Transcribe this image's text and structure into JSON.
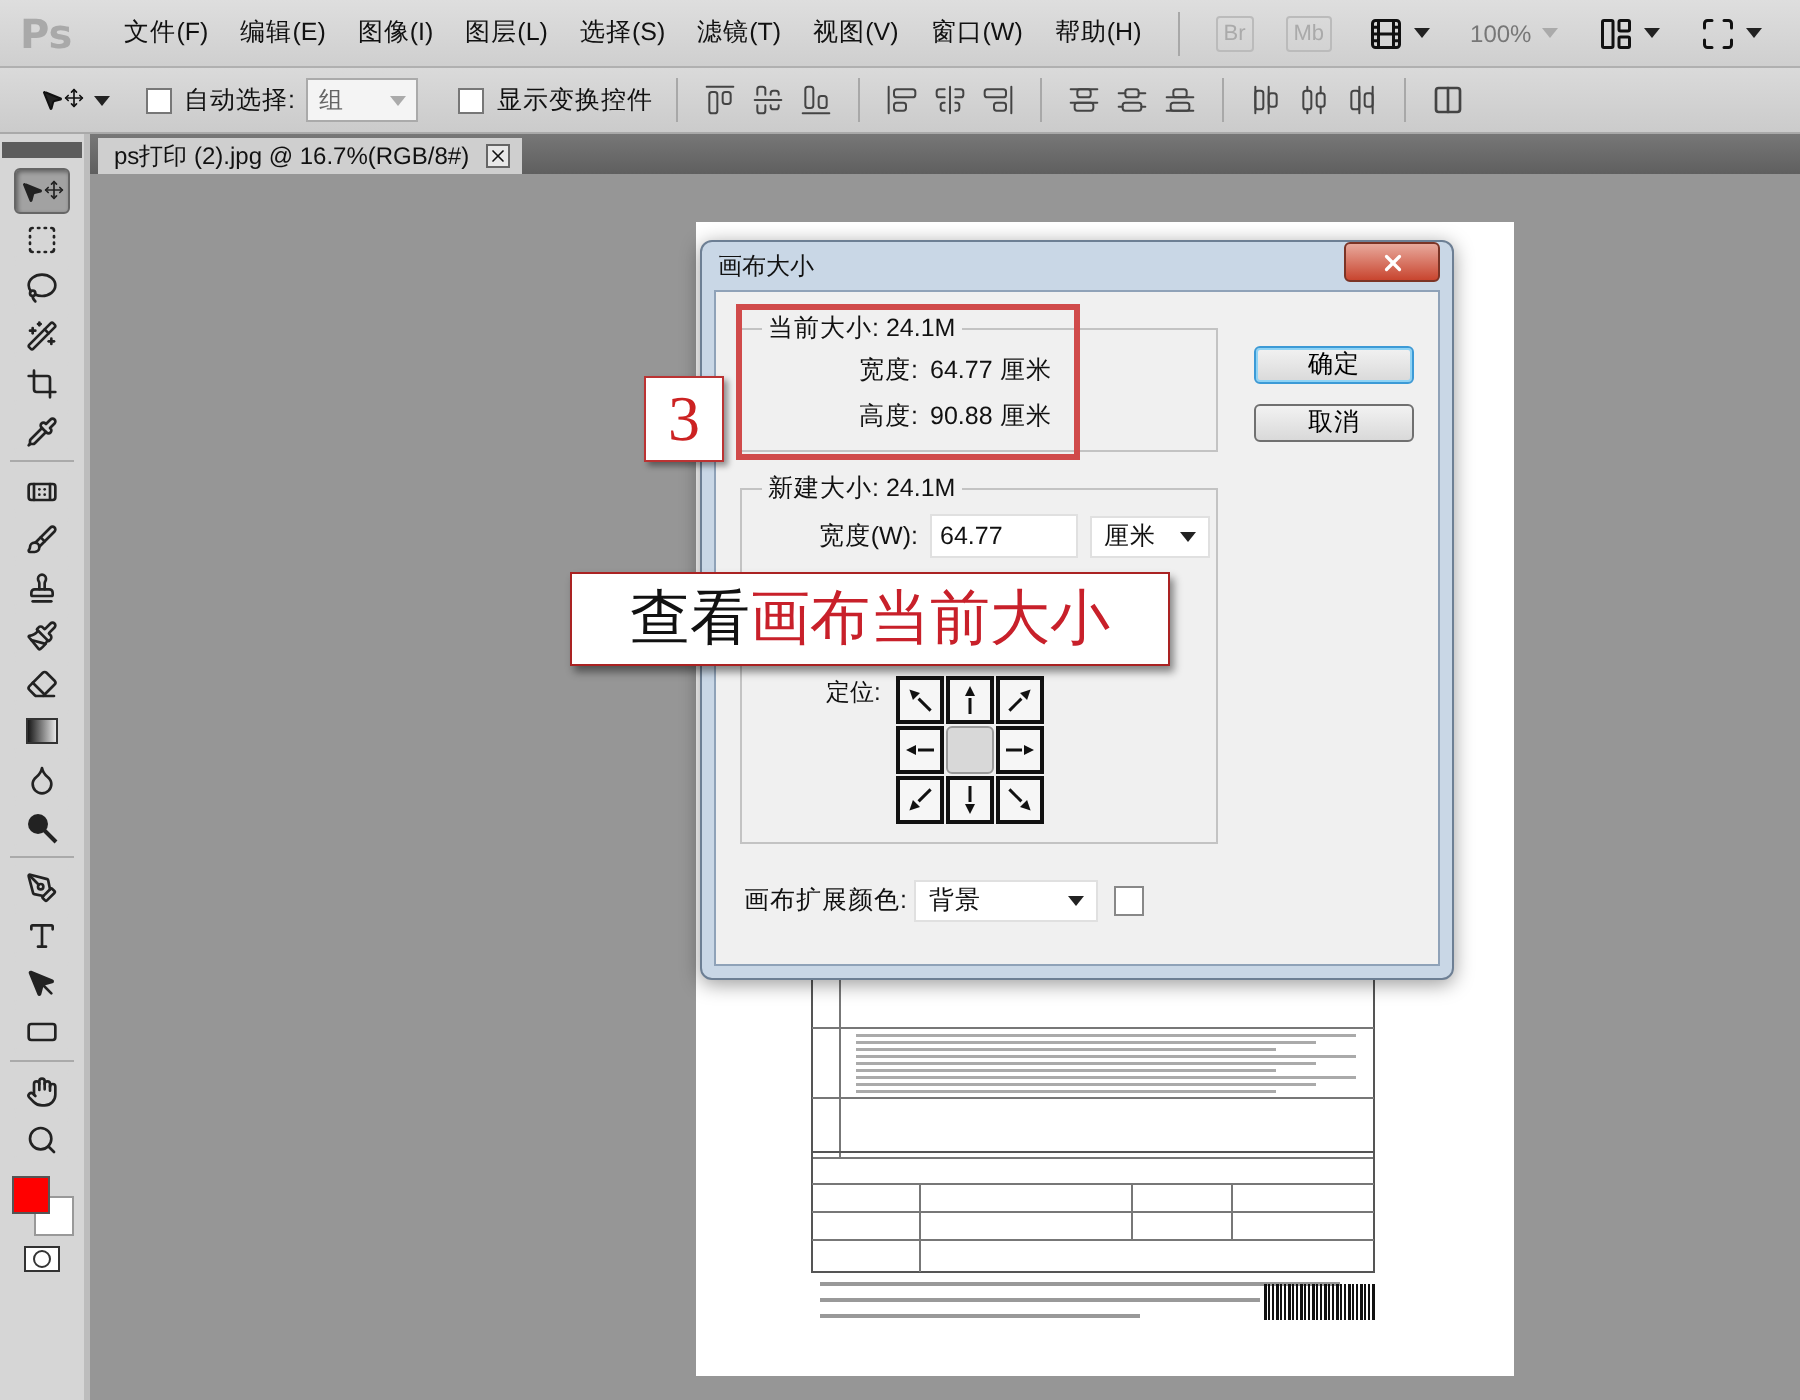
{
  "app_logo": "Ps",
  "menu": [
    "文件(F)",
    "编辑(E)",
    "图像(I)",
    "图层(L)",
    "选择(S)",
    "滤镜(T)",
    "视图(V)",
    "窗口(W)",
    "帮助(H)"
  ],
  "app_bar": {
    "bridge": "Br",
    "mini_bridge": "Mb",
    "zoom": "100%"
  },
  "options_bar": {
    "auto_select": {
      "label": "自动选择:",
      "checked": false
    },
    "auto_select_target": "组",
    "show_transform": {
      "label": "显示变换控件",
      "checked": false
    }
  },
  "document_tab": {
    "title": "ps打印 (2).jpg @ 16.7%(RGB/8#)"
  },
  "tool_groups": [
    [
      {
        "kind": "move",
        "selected": true
      },
      {
        "kind": "marquee",
        "selected": false
      },
      {
        "kind": "lasso",
        "selected": false
      },
      {
        "kind": "quick-select",
        "selected": false
      },
      {
        "kind": "crop",
        "selected": false
      },
      {
        "kind": "eyedropper",
        "selected": false
      }
    ],
    [
      {
        "kind": "healing",
        "selected": false
      },
      {
        "kind": "brush",
        "selected": false
      },
      {
        "kind": "stamp",
        "selected": false
      },
      {
        "kind": "history",
        "selected": false
      },
      {
        "kind": "eraser",
        "selected": false
      },
      {
        "kind": "gradient",
        "selected": false
      },
      {
        "kind": "blur",
        "selected": false
      },
      {
        "kind": "dodge",
        "selected": false
      }
    ],
    [
      {
        "kind": "pen",
        "selected": false
      },
      {
        "kind": "type",
        "selected": false
      },
      {
        "kind": "path",
        "selected": false
      },
      {
        "kind": "shape",
        "selected": false
      }
    ],
    [
      {
        "kind": "hand",
        "selected": false
      },
      {
        "kind": "zoom",
        "selected": false
      }
    ]
  ],
  "dialog": {
    "title": "画布大小",
    "current": {
      "legend": "当前大小: 24.1M",
      "rows": [
        {
          "label": "宽度:",
          "value": "64.77 厘米"
        },
        {
          "label": "高度:",
          "value": "90.88 厘米"
        }
      ]
    },
    "new": {
      "legend": "新建大小: 24.1M",
      "width_label": "宽度(W):",
      "width_value": "64.77",
      "width_unit": "厘米",
      "anchor_label": "定位:",
      "anchors": [
        {
          "selected": false
        },
        {
          "selected": false
        },
        {
          "selected": false
        },
        {
          "selected": false
        },
        {
          "selected": true
        },
        {
          "selected": false
        },
        {
          "selected": false
        },
        {
          "selected": false
        },
        {
          "selected": false
        }
      ]
    },
    "extension_label": "画布扩展颜色:",
    "extension_value": "背景",
    "buttons": [
      {
        "label": "确定",
        "default": true
      },
      {
        "label": "取消",
        "default": false
      }
    ]
  },
  "annotation": {
    "step": "3",
    "callout_prefix": "查看",
    "callout_highlight": "画布当前大小"
  }
}
